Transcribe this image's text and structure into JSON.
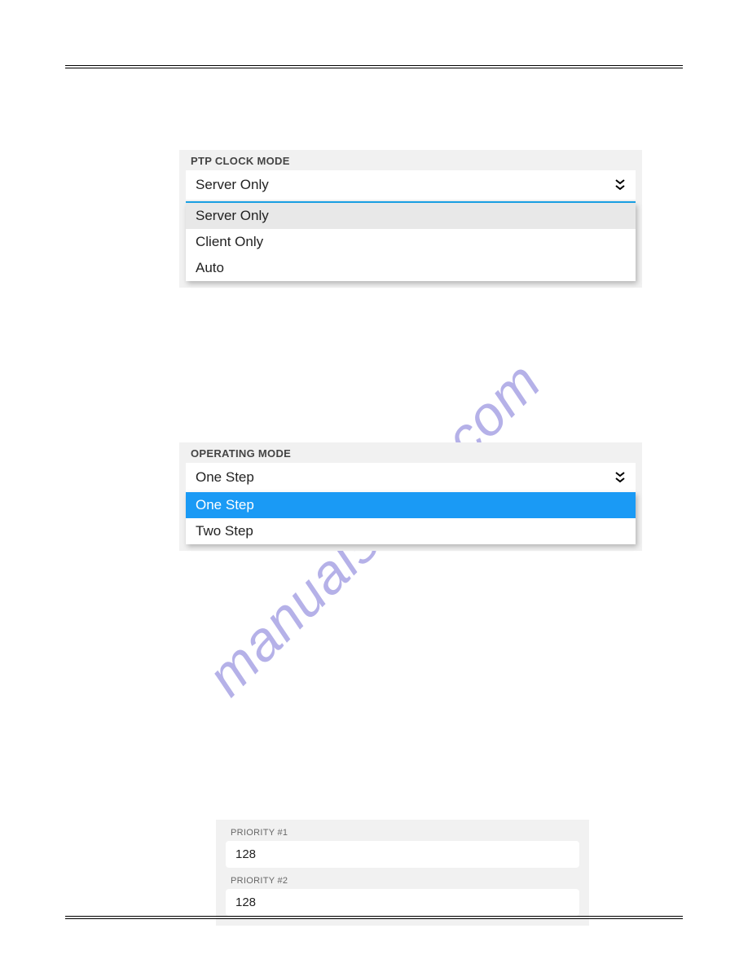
{
  "ptp_clock_mode": {
    "label": "PTP CLOCK MODE",
    "selected": "Server Only",
    "options": [
      "Server Only",
      "Client Only",
      "Auto"
    ]
  },
  "operating_mode": {
    "label": "OPERATING MODE",
    "selected": "One Step",
    "options": [
      "One Step",
      "Two Step"
    ]
  },
  "priority1": {
    "label": "PRIORITY #1",
    "value": "128"
  },
  "priority2": {
    "label": "PRIORITY #2",
    "value": "128"
  },
  "watermark": "manualshive.com"
}
